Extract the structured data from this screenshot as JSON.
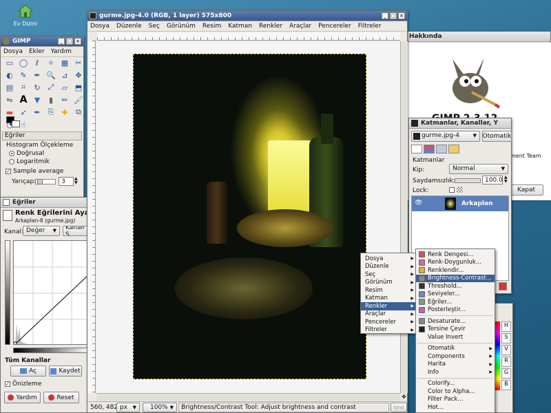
{
  "desktop": {
    "home_label": "Ev Dizini"
  },
  "toolbox": {
    "title": "GIMP",
    "menu": [
      "Dosya",
      "Ekler",
      "Yardım"
    ],
    "tools": [
      "rect-select",
      "ellipse-select",
      "free-select",
      "fuzzy-select",
      "color-select",
      "scissors",
      "foreground-select",
      "paths",
      "color-picker",
      "zoom",
      "measure",
      "move",
      "align",
      "crop",
      "rotate",
      "scale",
      "shear",
      "perspective",
      "flip",
      "text",
      "bucket-fill",
      "blend",
      "pencil",
      "paintbrush",
      "eraser",
      "airbrush",
      "ink",
      "clone",
      "heal",
      "perspective-clone",
      "dodge-burn",
      "smudge"
    ],
    "options_header": "Eğriler",
    "hist_scale": "Histogram Ölçekleme",
    "linear": "Doğrusal",
    "log": "Logaritmik",
    "sample_avg": "Sample average",
    "radius_label": "Yarıçap:",
    "radius_value": "3"
  },
  "curves": {
    "dock_title": "Eğriler",
    "title": "Renk Eğrilerini Ayarla",
    "subtitle": "Arkaplan-8 (gurme.jpg)",
    "channel_label": "Kanal:",
    "channel_value": "Değer",
    "reset_channel": "Kanalı S",
    "all_channels": "Tüm Kanallar",
    "open_btn": "Aç",
    "save_btn": "Kaydet",
    "preview": "Önizleme",
    "help_btn": "Yardım",
    "reset_btn": "Reset"
  },
  "image_window": {
    "title": "gurme.jpg-4.0 (RGB, 1 layer) 575x800",
    "menu": [
      "Dosya",
      "Düzenle",
      "Seç",
      "Görünüm",
      "Resim",
      "Katman",
      "Renkler",
      "Araçlar",
      "Pencereler",
      "Filtreler"
    ],
    "coords": "560, 482",
    "unit": "px",
    "zoom": "100%",
    "status": "Brightness/Contrast Tool: Adjust brightness and contrast",
    "cancel_btn": "İptal"
  },
  "about": {
    "title": "Hakkında",
    "app_name": "GIMP 2.3.12",
    "team_text": "ment Team",
    "close_btn": "Kapat"
  },
  "layers": {
    "title": "Katmanlar, Kanallar, Y",
    "image_select": "gurme.jpg-4",
    "auto_btn": "Otomatik",
    "section": "Katmanlar",
    "mode_label": "Kip:",
    "mode_value": "Normal",
    "opacity_label": "Saydamsızlık:",
    "opacity_value": "100.0",
    "lock_label": "Lock:",
    "layer_name": "Arkaplan"
  },
  "palette": {
    "labels": [
      "H",
      "S",
      "V",
      "R",
      "G",
      "B"
    ]
  },
  "context_menu": {
    "items": [
      "Dosya",
      "Düzenle",
      "Seç",
      "Görünüm",
      "Resim",
      "Katman",
      "Renkler",
      "Araçlar",
      "Pencereler",
      "Filtreler"
    ],
    "selected": "Renkler"
  },
  "colors_menu": {
    "group1": [
      {
        "label": "Renk Dengesi...",
        "color": "#c45a5a"
      },
      {
        "label": "Renk-Doygunluk...",
        "color": "#d06a9a"
      },
      {
        "label": "Renklendir...",
        "color": "#e0b030"
      },
      {
        "label": "Brightness-Contrast...",
        "color": "#888888"
      },
      {
        "label": "Threshold...",
        "color": "#333333"
      },
      {
        "label": "Seviyeler...",
        "color": "#6a8ac0"
      },
      {
        "label": "Eğriler...",
        "color": "#7aa07a"
      },
      {
        "label": "Posterleştir...",
        "color": "#c060c0"
      }
    ],
    "selected": "Brightness-Contrast...",
    "group2": [
      "Desaturate...",
      "Tersine Çevir",
      "Value Invert"
    ],
    "group3": [
      "Otomatik",
      "Components",
      "Harita",
      "Info"
    ],
    "group4": [
      "Colorify...",
      "Color to Alpha...",
      "Filter Pack...",
      "Hot..."
    ]
  }
}
